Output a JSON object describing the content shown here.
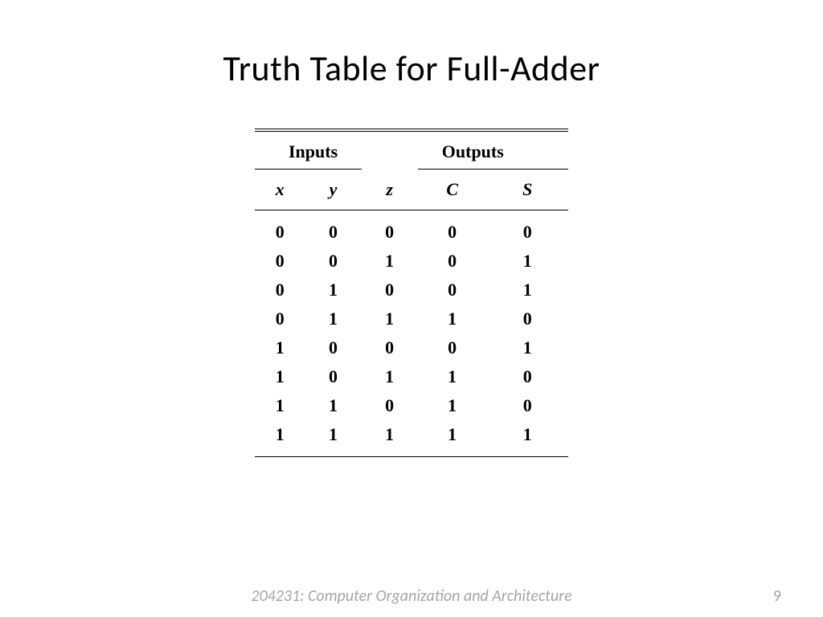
{
  "title": "Truth Table for Full-Adder",
  "table": {
    "group_headers": {
      "inputs": "Inputs",
      "outputs": "Outputs"
    },
    "columns": {
      "x": "x",
      "y": "y",
      "z": "z",
      "c": "C",
      "s": "S"
    },
    "rows": [
      {
        "x": "0",
        "y": "0",
        "z": "0",
        "c": "0",
        "s": "0"
      },
      {
        "x": "0",
        "y": "0",
        "z": "1",
        "c": "0",
        "s": "1"
      },
      {
        "x": "0",
        "y": "1",
        "z": "0",
        "c": "0",
        "s": "1"
      },
      {
        "x": "0",
        "y": "1",
        "z": "1",
        "c": "1",
        "s": "0"
      },
      {
        "x": "1",
        "y": "0",
        "z": "0",
        "c": "0",
        "s": "1"
      },
      {
        "x": "1",
        "y": "0",
        "z": "1",
        "c": "1",
        "s": "0"
      },
      {
        "x": "1",
        "y": "1",
        "z": "0",
        "c": "1",
        "s": "0"
      },
      {
        "x": "1",
        "y": "1",
        "z": "1",
        "c": "1",
        "s": "1"
      }
    ]
  },
  "footer": {
    "course": "204231: Computer Organization and Architecture",
    "page": "9"
  }
}
